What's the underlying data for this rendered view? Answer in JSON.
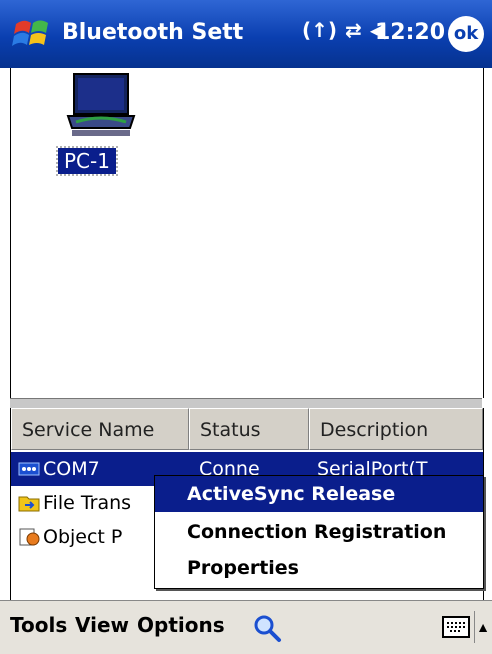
{
  "titlebar": {
    "title": "Bluetooth Sett",
    "signal_icon": "(↑)",
    "sync_icon": "⇄",
    "speaker_icon": "◀",
    "time": "12:20",
    "ok_label": "ok"
  },
  "device": {
    "name": "PC-1"
  },
  "columns": {
    "service": "Service Name",
    "status": "Status",
    "description": "Description"
  },
  "services": [
    {
      "name": "COM7",
      "status": "Conne",
      "description": "SerialPort(T"
    },
    {
      "name": "File Trans",
      "status": "",
      "description": ""
    },
    {
      "name": "Object P",
      "status": "",
      "description": ""
    }
  ],
  "context_menu": {
    "items": [
      "ActiveSync Release",
      "Connection Registration",
      "Properties"
    ]
  },
  "bottombar": {
    "tools": "Tools",
    "view": "View",
    "options": "Options",
    "sip_arrow": "▲"
  },
  "colors": {
    "titlebar": "#0a3fb0",
    "selection": "#0a1e8c"
  }
}
